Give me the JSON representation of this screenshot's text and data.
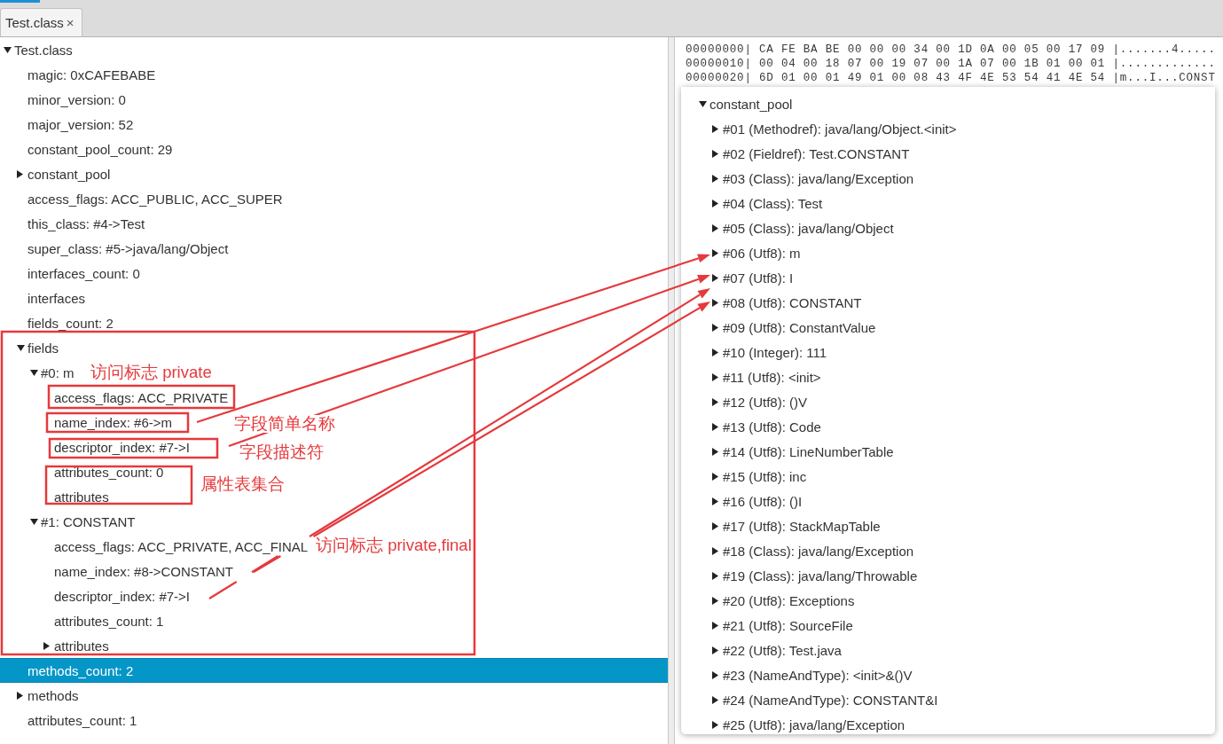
{
  "tabs": [
    {
      "label": "Test.class",
      "close": "×",
      "selected": true
    }
  ],
  "structure_tree": {
    "items": [
      {
        "label": "Test.class",
        "expanded": true,
        "selected": false,
        "children": [
          {
            "label": "magic: 0xCAFEBABE",
            "selected": false
          },
          {
            "label": "minor_version: 0",
            "selected": false
          },
          {
            "label": "major_version: 52",
            "selected": false
          },
          {
            "label": "constant_pool_count: 29",
            "selected": false
          },
          {
            "label": "constant_pool",
            "expanded": false,
            "selected": false
          },
          {
            "label": "access_flags: ACC_PUBLIC, ACC_SUPER",
            "selected": false
          },
          {
            "label": "this_class: #4->Test",
            "selected": false
          },
          {
            "label": "super_class: #5->java/lang/Object",
            "selected": false
          },
          {
            "label": "interfaces_count: 0",
            "selected": false
          },
          {
            "label": "interfaces",
            "selected": false
          },
          {
            "label": "fields_count: 2",
            "selected": false
          },
          {
            "label": "fields",
            "expanded": true,
            "selected": false,
            "children": [
              {
                "label": "#0: m",
                "expanded": true,
                "selected": false,
                "children": [
                  {
                    "label": "access_flags: ACC_PRIVATE",
                    "selected": false
                  },
                  {
                    "label": "name_index: #6->m",
                    "selected": false
                  },
                  {
                    "label": "descriptor_index: #7->I",
                    "selected": false
                  },
                  {
                    "label": "attributes_count: 0",
                    "selected": false
                  },
                  {
                    "label": "attributes",
                    "selected": false
                  }
                ]
              },
              {
                "label": "#1: CONSTANT",
                "expanded": true,
                "selected": false,
                "children": [
                  {
                    "label": "access_flags: ACC_PRIVATE, ACC_FINAL",
                    "selected": false
                  },
                  {
                    "label": "name_index: #8->CONSTANT",
                    "selected": false
                  },
                  {
                    "label": "descriptor_index: #7->I",
                    "selected": false
                  },
                  {
                    "label": "attributes_count: 1",
                    "selected": false
                  },
                  {
                    "label": "attributes",
                    "expanded": false,
                    "selected": false
                  }
                ]
              }
            ]
          },
          {
            "label": "methods_count: 2",
            "selected": true
          },
          {
            "label": "methods",
            "expanded": false,
            "selected": false
          },
          {
            "label": "attributes_count: 1",
            "selected": false
          }
        ]
      }
    ]
  },
  "hex_dump": {
    "lines": [
      {
        "offset": "00000000|",
        "bytes": "CA FE BA BE 00 00 00 34 00 1D 0A 00 05 00 17 09",
        "ascii": "|.......4....."
      },
      {
        "offset": "00000010|",
        "bytes": "00 04 00 18 07 00 19 07 00 1A 07 00 1B 01 00 01",
        "ascii": "|............."
      },
      {
        "offset": "00000020|",
        "bytes": "6D 01 00 01 49 01 00 08 43 4F 4E 53 54 41 4E 54",
        "ascii": "|m...I...CONST"
      }
    ]
  },
  "constant_pool_popup": {
    "items": [
      {
        "label": "constant_pool",
        "expanded": true,
        "selected": false,
        "children": [
          {
            "label": "#01 (Methodref): java/lang/Object.<init>",
            "expanded": false,
            "selected": false
          },
          {
            "label": "#02 (Fieldref): Test.CONSTANT",
            "expanded": false,
            "selected": false
          },
          {
            "label": "#03 (Class): java/lang/Exception",
            "expanded": false,
            "selected": false
          },
          {
            "label": "#04 (Class): Test",
            "expanded": false,
            "selected": false
          },
          {
            "label": "#05 (Class): java/lang/Object",
            "expanded": false,
            "selected": false
          },
          {
            "label": "#06 (Utf8): m",
            "expanded": false,
            "selected": false
          },
          {
            "label": "#07 (Utf8): I",
            "expanded": false,
            "selected": false
          },
          {
            "label": "#08 (Utf8): CONSTANT",
            "expanded": false,
            "selected": false
          },
          {
            "label": "#09 (Utf8): ConstantValue",
            "expanded": false,
            "selected": false
          },
          {
            "label": "#10 (Integer): 111",
            "expanded": false,
            "selected": false
          },
          {
            "label": "#11 (Utf8): <init>",
            "expanded": false,
            "selected": false
          },
          {
            "label": "#12 (Utf8): ()V",
            "expanded": false,
            "selected": false
          },
          {
            "label": "#13 (Utf8): Code",
            "expanded": false,
            "selected": false
          },
          {
            "label": "#14 (Utf8): LineNumberTable",
            "expanded": false,
            "selected": false
          },
          {
            "label": "#15 (Utf8): inc",
            "expanded": false,
            "selected": false
          },
          {
            "label": "#16 (Utf8): ()I",
            "expanded": false,
            "selected": false
          },
          {
            "label": "#17 (Utf8): StackMapTable",
            "expanded": false,
            "selected": false
          },
          {
            "label": "#18 (Class): java/lang/Exception",
            "expanded": false,
            "selected": false
          },
          {
            "label": "#19 (Class): java/lang/Throwable",
            "expanded": false,
            "selected": false
          },
          {
            "label": "#20 (Utf8): Exceptions",
            "expanded": false,
            "selected": false
          },
          {
            "label": "#21 (Utf8): SourceFile",
            "expanded": false,
            "selected": false
          },
          {
            "label": "#22 (Utf8): Test.java",
            "expanded": false,
            "selected": false
          },
          {
            "label": "#23 (NameAndType): <init>&()V",
            "expanded": false,
            "selected": false
          },
          {
            "label": "#24 (NameAndType): CONSTANT&I",
            "expanded": false,
            "selected": false
          },
          {
            "label": "#25 (Utf8): java/lang/Exception",
            "expanded": false,
            "selected": false
          }
        ]
      }
    ]
  },
  "annotations": {
    "labels": [
      "访问标志 private",
      "字段简单名称",
      "字段描述符",
      "属性表集合",
      "访问标志 private,final"
    ]
  }
}
